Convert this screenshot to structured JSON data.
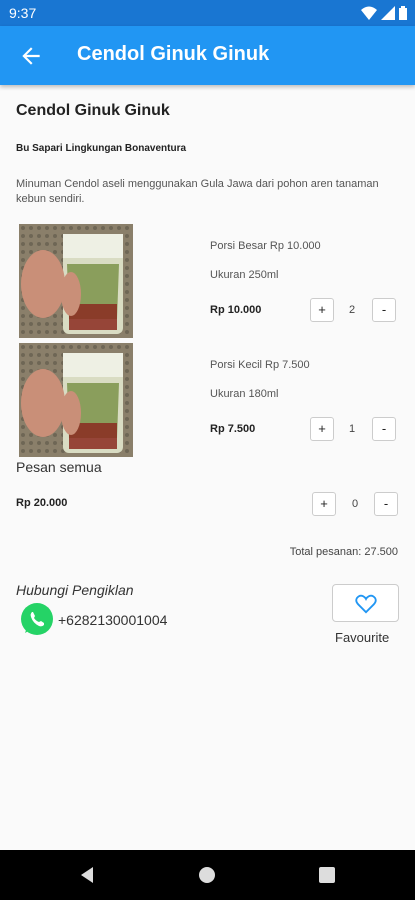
{
  "status_bar": {
    "time": "9:37"
  },
  "app_bar": {
    "title": "Cendol Ginuk Ginuk"
  },
  "product": {
    "title": "Cendol Ginuk Ginuk",
    "seller": "Bu Sapari Lingkungan Bonaventura",
    "description": "Minuman Cendol aseli menggunakan Gula Jawa dari pohon aren tanaman kebun sendiri."
  },
  "options": [
    {
      "name": "Porsi Besar Rp 10.000",
      "size": "Ukuran 250ml",
      "price": "Rp 10.000",
      "qty": "2"
    },
    {
      "name": "Porsi Kecil Rp 7.500",
      "size": "Ukuran 180ml",
      "price": "Rp 7.500",
      "qty": "1"
    }
  ],
  "order_all": {
    "label": "Pesan semua",
    "price": "Rp 20.000",
    "qty": "0"
  },
  "stepper": {
    "plus": "+",
    "minus": "-"
  },
  "total": "Total pesanan: 27.500",
  "contact": {
    "label": "Hubungi Pengiklan",
    "phone": "+6282130001004"
  },
  "favourite": {
    "label": "Favourite"
  },
  "colors": {
    "status_bar": "#1976d2",
    "app_bar": "#2196f3",
    "whatsapp": "#25d366",
    "heart": "#2196f3"
  },
  "icons": [
    "back-arrow-icon",
    "wifi-icon",
    "signal-icon",
    "battery-icon",
    "whatsapp-icon",
    "heart-icon",
    "nav-back-icon",
    "nav-home-icon",
    "nav-recents-icon"
  ]
}
